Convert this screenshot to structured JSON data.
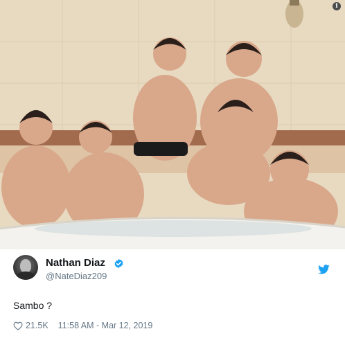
{
  "tweet": {
    "author_name": "Nathan Diaz",
    "author_handle": "@NateDiaz209",
    "text": "Sambo ?",
    "likes": "21.5K",
    "timestamp": "11:58 AM - Mar 12, 2019",
    "verified": true
  },
  "icons": {
    "verified": "verified-badge-icon",
    "bird": "twitter-bird-icon",
    "heart": "heart-icon",
    "info": "info-icon"
  },
  "colors": {
    "twitter_blue": "#1da1f2",
    "secondary_text": "#657786",
    "primary_text": "#14171a"
  }
}
